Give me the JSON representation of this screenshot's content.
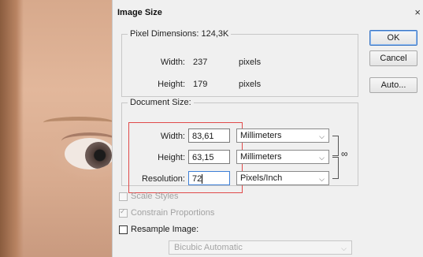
{
  "window": {
    "title": "Image Size",
    "close_glyph": "×"
  },
  "pixel_dimensions": {
    "legend": "Pixel Dimensions:  124,3K",
    "width": {
      "label": "Width:",
      "value": "237",
      "unit": "pixels"
    },
    "height": {
      "label": "Height:",
      "value": "179",
      "unit": "pixels"
    }
  },
  "document_size": {
    "legend": "Document Size:",
    "width": {
      "label": "Width:",
      "value": "83,61",
      "unit": "Millimeters"
    },
    "height": {
      "label": "Height:",
      "value": "63,15",
      "unit": "Millimeters"
    },
    "resolution": {
      "label": "Resolution:",
      "value": "72",
      "unit": "Pixels/Inch"
    },
    "link_icon": "chain-link-icon"
  },
  "options": {
    "scale_styles": {
      "label": "Scale Styles",
      "checked": false,
      "enabled": false
    },
    "constrain_proportions": {
      "label": "Constrain Proportions",
      "checked": true,
      "enabled": false
    },
    "resample_image": {
      "label": "Resample Image:",
      "checked": false,
      "enabled": true
    },
    "resample_method": "Bicubic Automatic"
  },
  "buttons": {
    "ok": "OK",
    "cancel": "Cancel",
    "auto": "Auto..."
  },
  "colors": {
    "highlight_box": "#e04a4a",
    "focus": "#3d7fd6"
  }
}
